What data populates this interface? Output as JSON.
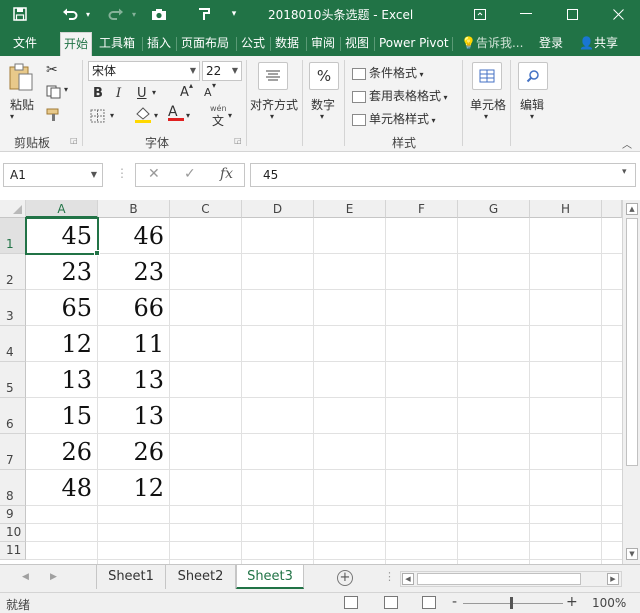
{
  "titlebar": {
    "title": "2018010头条选题 - Excel",
    "save_icon": "save-icon",
    "undo_icon": "undo-icon",
    "redo_icon": "redo-icon",
    "camera_icon": "camera-icon",
    "brush_icon": "format-painter-icon"
  },
  "tabs": [
    {
      "label": "文件"
    },
    {
      "label": "开始"
    },
    {
      "label": "工具箱"
    },
    {
      "label": "插入"
    },
    {
      "label": "页面布局"
    },
    {
      "label": "公式"
    },
    {
      "label": "数据"
    },
    {
      "label": "审阅"
    },
    {
      "label": "视图"
    },
    {
      "label": "Power Pivot"
    }
  ],
  "tab_extra": {
    "tell_me": "告诉我...",
    "login": "登录",
    "share": "共享"
  },
  "ribbon": {
    "clipboard": {
      "paste": "粘贴",
      "label": "剪贴板"
    },
    "font": {
      "name": "宋体",
      "size": "22",
      "bold": "B",
      "italic": "I",
      "underline": "U",
      "grow": "A",
      "shrink": "A",
      "color_letter": "A",
      "wen": "wén",
      "label": "字体"
    },
    "alignment": {
      "label": "对齐方式"
    },
    "number": {
      "label": "数字",
      "symbol": "%"
    },
    "styles": {
      "conditional": "条件格式",
      "table": "套用表格格式",
      "cell_style": "单元格样式",
      "label": "样式"
    },
    "cells": {
      "label": "单元格"
    },
    "editing": {
      "label": "编辑"
    }
  },
  "formula_bar": {
    "name_box": "A1",
    "cancel": "✕",
    "confirm": "✓",
    "fx": "fx",
    "value": "45"
  },
  "columns": [
    "A",
    "B",
    "C",
    "D",
    "E",
    "F",
    "G",
    "H"
  ],
  "rows": [
    "1",
    "2",
    "3",
    "4",
    "5",
    "6",
    "7",
    "8",
    "9",
    "10",
    "11"
  ],
  "cells": [
    [
      "45",
      "46"
    ],
    [
      "23",
      "23"
    ],
    [
      "65",
      "66"
    ],
    [
      "12",
      "11"
    ],
    [
      "13",
      "13"
    ],
    [
      "15",
      "13"
    ],
    [
      "26",
      "26"
    ],
    [
      "48",
      "12"
    ]
  ],
  "sheets": [
    {
      "name": "Sheet1"
    },
    {
      "name": "Sheet2"
    },
    {
      "name": "Sheet3"
    }
  ],
  "status": {
    "ready": "就绪",
    "zoom": "100%",
    "zoom_minus": "-",
    "zoom_plus": "+"
  },
  "colors": {
    "accent": "#217346"
  }
}
